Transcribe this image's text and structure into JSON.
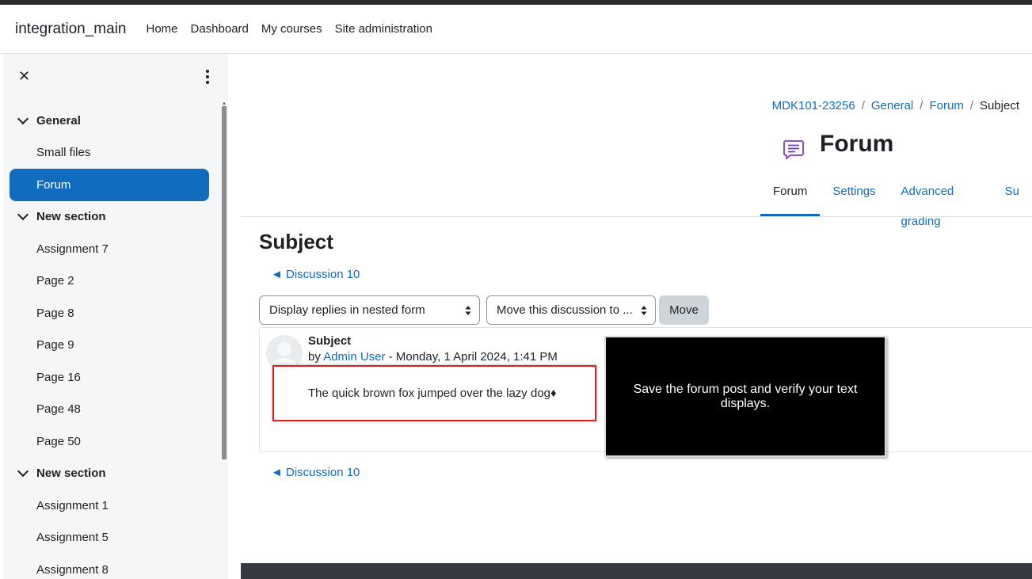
{
  "navbar": {
    "brand": "integration_main",
    "links": [
      "Home",
      "Dashboard",
      "My courses",
      "Site administration"
    ]
  },
  "drawer": {
    "close_icon": "close-icon",
    "menu_icon": "kebab-menu-icon",
    "course_index": [
      {
        "type": "section",
        "label": "General"
      },
      {
        "type": "item",
        "label": "Small files"
      },
      {
        "type": "item",
        "label": "Forum",
        "active": true
      },
      {
        "type": "section",
        "label": "New section"
      },
      {
        "type": "item",
        "label": "Assignment 7"
      },
      {
        "type": "item",
        "label": "Page 2"
      },
      {
        "type": "item",
        "label": "Page 8"
      },
      {
        "type": "item",
        "label": "Page 9"
      },
      {
        "type": "item",
        "label": "Page 16"
      },
      {
        "type": "item",
        "label": "Page 48"
      },
      {
        "type": "item",
        "label": "Page 50"
      },
      {
        "type": "section",
        "label": "New section"
      },
      {
        "type": "item",
        "label": "Assignment 1"
      },
      {
        "type": "item",
        "label": "Assignment 5"
      },
      {
        "type": "item",
        "label": "Assignment 8"
      }
    ]
  },
  "breadcrumb": [
    "MDK101-23256",
    "General",
    "Forum",
    "Subject"
  ],
  "header": {
    "title": "Forum",
    "icon": "forum-icon"
  },
  "tabs": [
    {
      "label": "Forum",
      "active": true
    },
    {
      "label": "Settings"
    },
    {
      "label": "Advanced grading"
    },
    {
      "label": "Su"
    }
  ],
  "discussion": {
    "title": "Subject",
    "nav_link": "◄ Discussion 10",
    "display_select": "Display replies in nested form",
    "move_select": "Move this discussion to ...",
    "move_button": "Move"
  },
  "post": {
    "subject": "Subject",
    "by": "by ",
    "author": "Admin User",
    "date": " - Monday, 1 April 2024, 1:41 PM",
    "body": "The quick brown fox jumped over the lazy dog♦"
  },
  "tooltip": {
    "text": "Save the forum post and verify your text displays."
  },
  "colors": {
    "accent": "#0f6cbf",
    "highlight": "#e02020",
    "forum_icon": "#7e3bd0"
  }
}
